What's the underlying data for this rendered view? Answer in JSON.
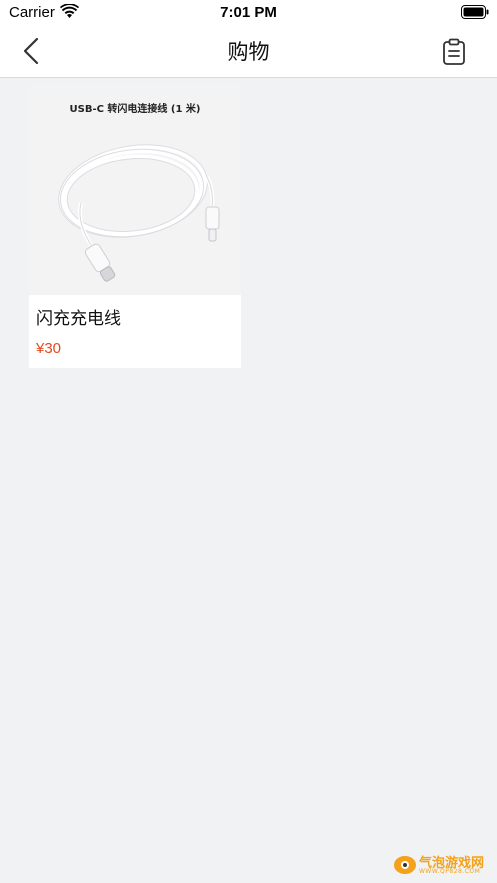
{
  "status_bar": {
    "carrier": "Carrier",
    "time": "7:01 PM"
  },
  "nav": {
    "title": "购物",
    "back_icon": "chevron-left-icon",
    "right_icon": "clipboard-icon"
  },
  "products": [
    {
      "image_caption": "USB-C 转闪电连接线 (1 米)",
      "name": "闪充充电线",
      "price": "¥30"
    }
  ],
  "watermark": {
    "text": "气泡游戏网",
    "sub": "WWW.QP828.COM"
  },
  "colors": {
    "background": "#f1f2f4",
    "price": "#e24a1d",
    "watermark": "#f3a21a"
  }
}
